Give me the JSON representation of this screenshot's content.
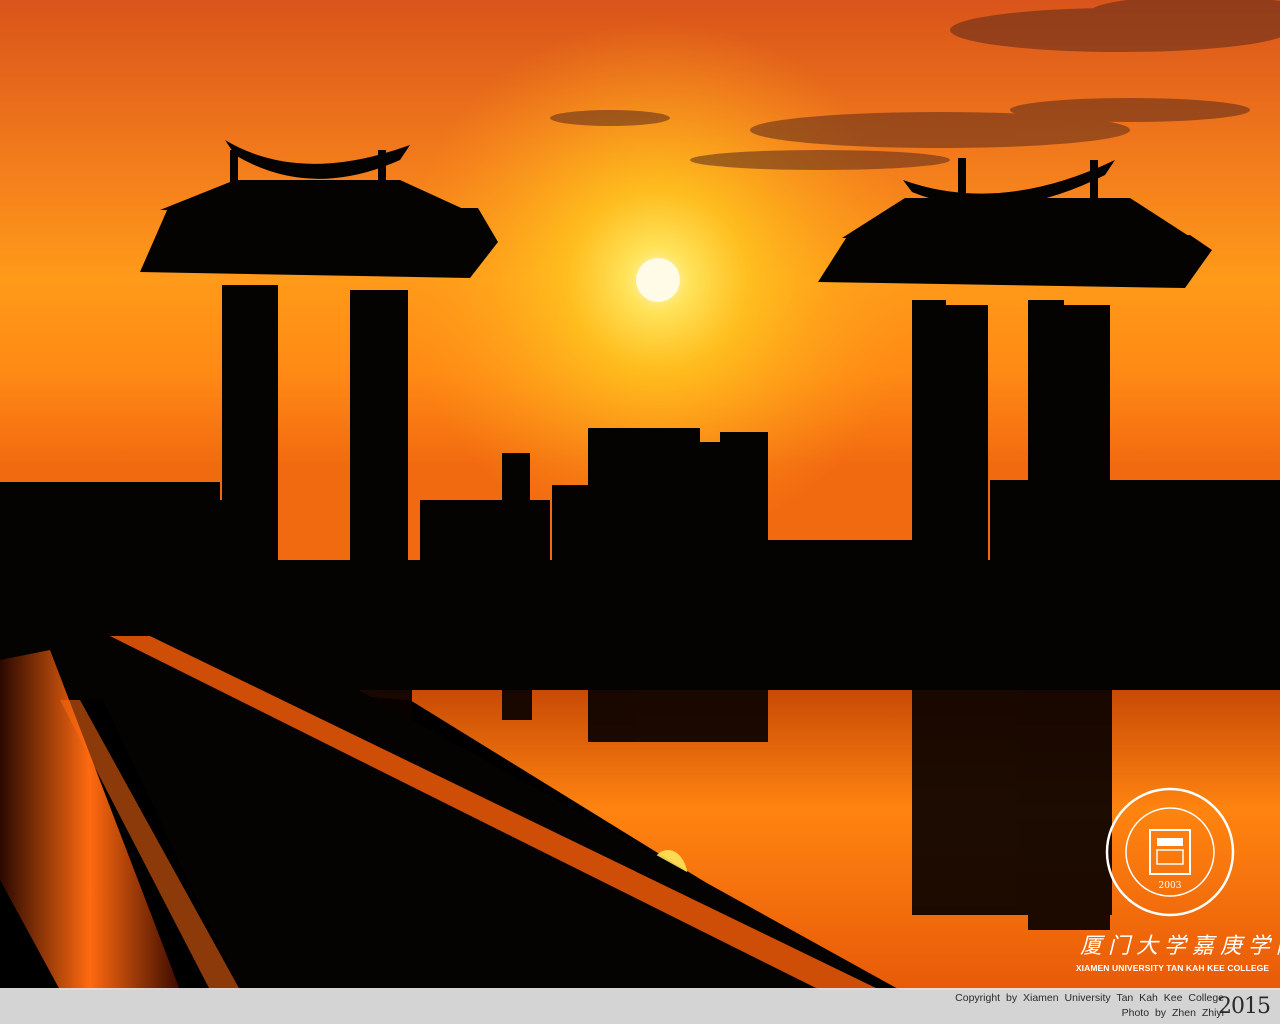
{
  "photo": {
    "subject": "sunset-gate-silhouette",
    "colors": {
      "sky_top": "#e8601a",
      "sky_glow": "#ffb21a",
      "sun": "#fff6c8",
      "silhouette": "#050202",
      "water": "#ff7a10"
    }
  },
  "watermark": {
    "seal_text_top": "厦門大學嘉庚學院",
    "seal_text_bottom": "XIAMEN UNIVERSITY TAN KAH KEE COLLEGE",
    "seal_year": "2003",
    "calligraphy": "厦门大学嘉庚学院",
    "college_name": "XIAMEN UNIVERSITY TAN KAH KEE COLLEGE"
  },
  "credits": {
    "copyright": "Copyright by Xiamen University Tan Kah Kee College",
    "photographer": "Photo by Zhen Zhiyi",
    "year": "2015"
  }
}
